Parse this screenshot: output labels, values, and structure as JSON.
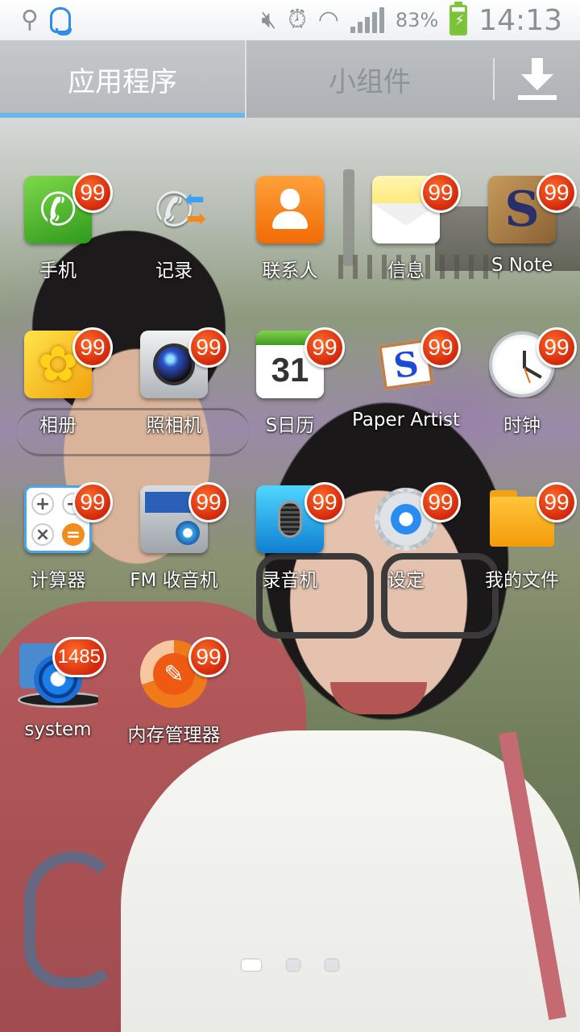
{
  "status_bar": {
    "battery_percent": "83%",
    "time": "14:13",
    "icons": [
      "usb-icon",
      "qq-icon",
      "mute-icon",
      "alarm-icon",
      "wifi-icon",
      "signal-icon",
      "battery-charging-icon"
    ]
  },
  "tabs": [
    {
      "label": "应用程序",
      "active": true
    },
    {
      "label": "小组件",
      "active": false
    }
  ],
  "download_icon": "download-icon",
  "apps": [
    {
      "label": "手机",
      "badge": "99",
      "icon": "phone-icon"
    },
    {
      "label": "记录",
      "badge": "",
      "icon": "call-log-icon"
    },
    {
      "label": "联系人",
      "badge": "",
      "icon": "contacts-icon"
    },
    {
      "label": "信息",
      "badge": "99",
      "icon": "messages-icon"
    },
    {
      "label": "S Note",
      "badge": "99",
      "icon": "s-note-icon"
    },
    {
      "label": "相册",
      "badge": "99",
      "icon": "gallery-icon"
    },
    {
      "label": "照相机",
      "badge": "99",
      "icon": "camera-icon"
    },
    {
      "label": "S日历",
      "badge": "99",
      "icon": "calendar-icon",
      "calendar_day": "31"
    },
    {
      "label": "Paper Artist",
      "badge": "99",
      "icon": "paper-artist-icon"
    },
    {
      "label": "时钟",
      "badge": "99",
      "icon": "clock-icon"
    },
    {
      "label": "计算器",
      "badge": "99",
      "icon": "calculator-icon"
    },
    {
      "label": "FM 收音机",
      "badge": "99",
      "icon": "radio-icon"
    },
    {
      "label": "录音机",
      "badge": "99",
      "icon": "voice-recorder-icon"
    },
    {
      "label": "设定",
      "badge": "99",
      "icon": "settings-icon"
    },
    {
      "label": "我的文件",
      "badge": "99",
      "icon": "my-files-icon"
    },
    {
      "label": "system",
      "badge": "1485",
      "icon": "system-icon"
    },
    {
      "label": "内存管理器",
      "badge": "99",
      "icon": "memory-manager-icon"
    }
  ],
  "pager": {
    "pages": 3,
    "current": 1
  },
  "colors": {
    "badge": "#d3280b",
    "tab_active_underline": "#6fb6e8",
    "status_icons": "#8c9196"
  }
}
